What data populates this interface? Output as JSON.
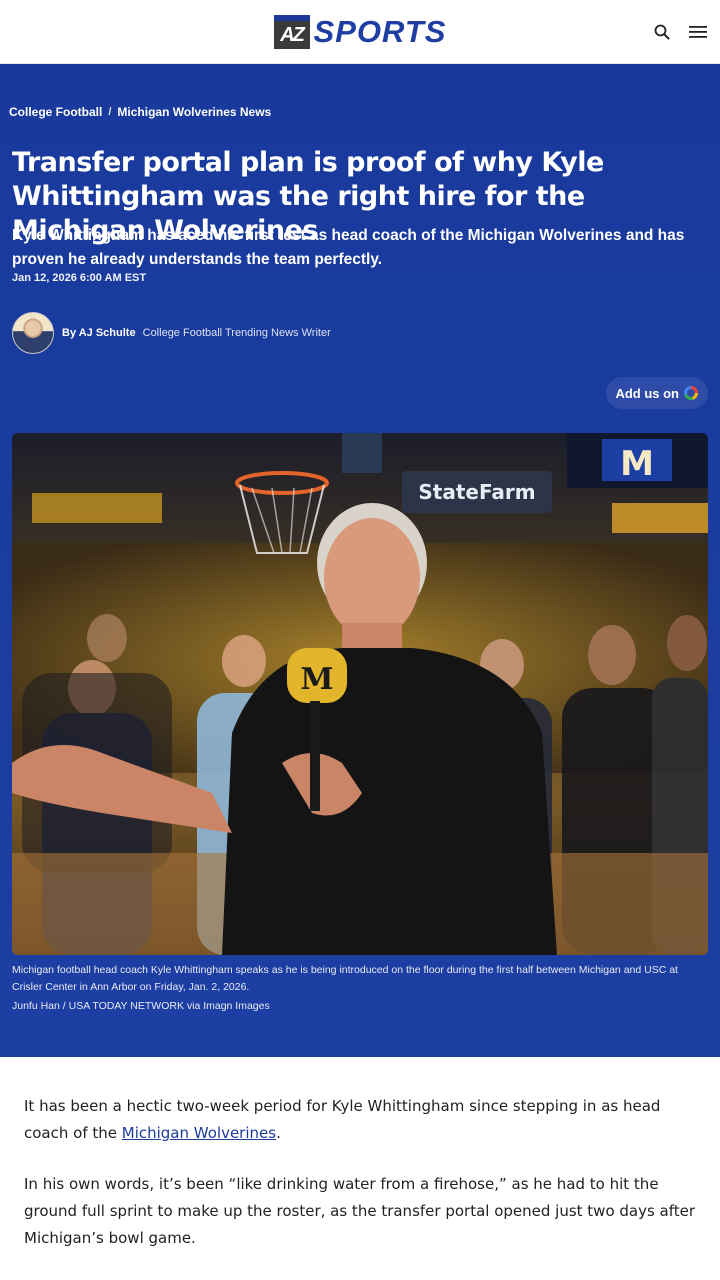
{
  "header": {
    "logo_mark": "AZ",
    "logo_text": "SPORTS",
    "icons": [
      "search-icon",
      "menu-icon"
    ]
  },
  "breadcrumb": {
    "items": [
      "College Football",
      "Michigan Wolverines News"
    ],
    "separator": "/"
  },
  "article": {
    "headline": "Transfer portal plan is proof of why Kyle Whittingham was the right hire for the Michigan Wolverines",
    "dek": "Kyle Whittingham has aced his first test as head coach of the Michigan Wolverines and has proven he already understands the team perfectly.",
    "date": "Jan 12, 2026 6:00 AM EST",
    "author": {
      "by_label": "By AJ Schulte",
      "role": "College Football Trending News Writer"
    },
    "add_us_label": "Add us on",
    "image": {
      "caption": "Michigan football head coach Kyle Whittingham speaks as he is being introduced on the floor during the first half between Michigan and USC at Crisler Center in Ann Arbor on Friday, Jan. 2, 2026.",
      "credit": "Junfu Han / USA TODAY NETWORK via Imagn Images",
      "sign_text": "StateFarm",
      "mic_text": "M",
      "scoreboard_text": "M"
    },
    "paragraphs": [
      {
        "before": "It has been a hectic two-week period for Kyle Whittingham since stepping in as head coach of the ",
        "link": "Michigan Wolverines",
        "after": "."
      },
      {
        "text": "In his own words, it’s been “like drinking water from a firehose,” as he had to hit the ground full sprint to make up the roster, as the transfer portal opened just two days after Michigan’s bowl game."
      }
    ]
  },
  "colors": {
    "hero_bg": "#1c3b9c",
    "brand_blue": "#1f3ea3",
    "link": "#1c3b9c"
  }
}
